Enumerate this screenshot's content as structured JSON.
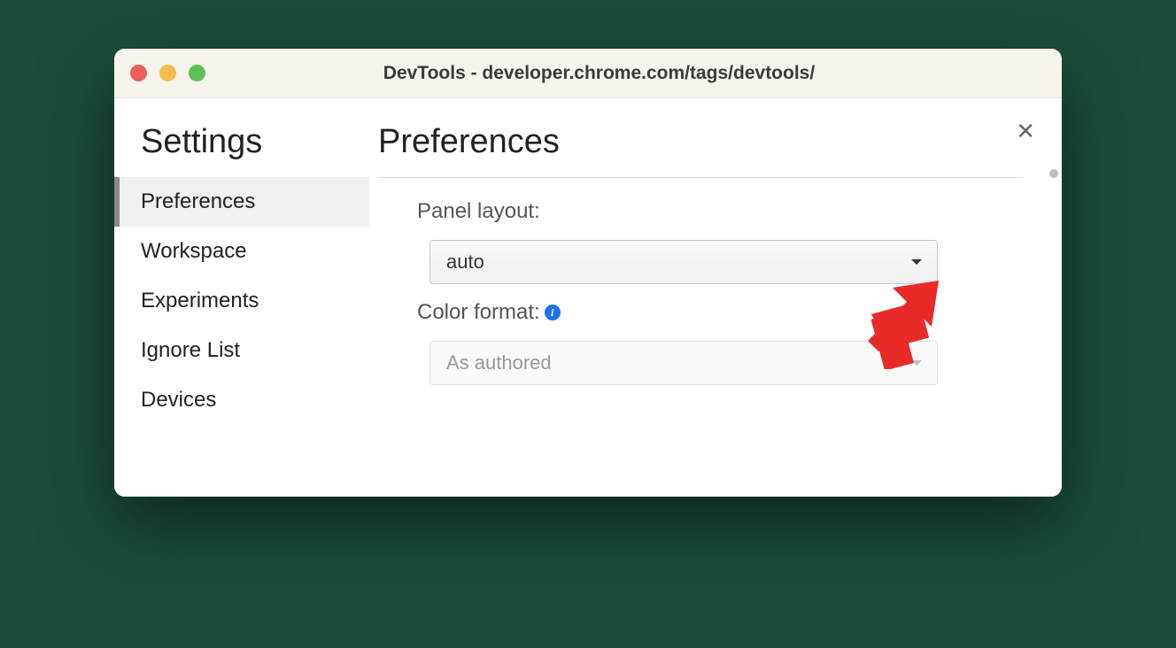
{
  "window": {
    "title": "DevTools - developer.chrome.com/tags/devtools/"
  },
  "sidebar": {
    "heading": "Settings",
    "items": [
      {
        "label": "Preferences",
        "active": true
      },
      {
        "label": "Workspace",
        "active": false
      },
      {
        "label": "Experiments",
        "active": false
      },
      {
        "label": "Ignore List",
        "active": false
      },
      {
        "label": "Devices",
        "active": false
      }
    ]
  },
  "main": {
    "heading": "Preferences",
    "panel_layout": {
      "label": "Panel layout:",
      "value": "auto"
    },
    "color_format": {
      "label": "Color format:",
      "value": "As authored",
      "info_glyph": "i"
    }
  },
  "annotation": {
    "arrow_color": "#e82a29"
  }
}
